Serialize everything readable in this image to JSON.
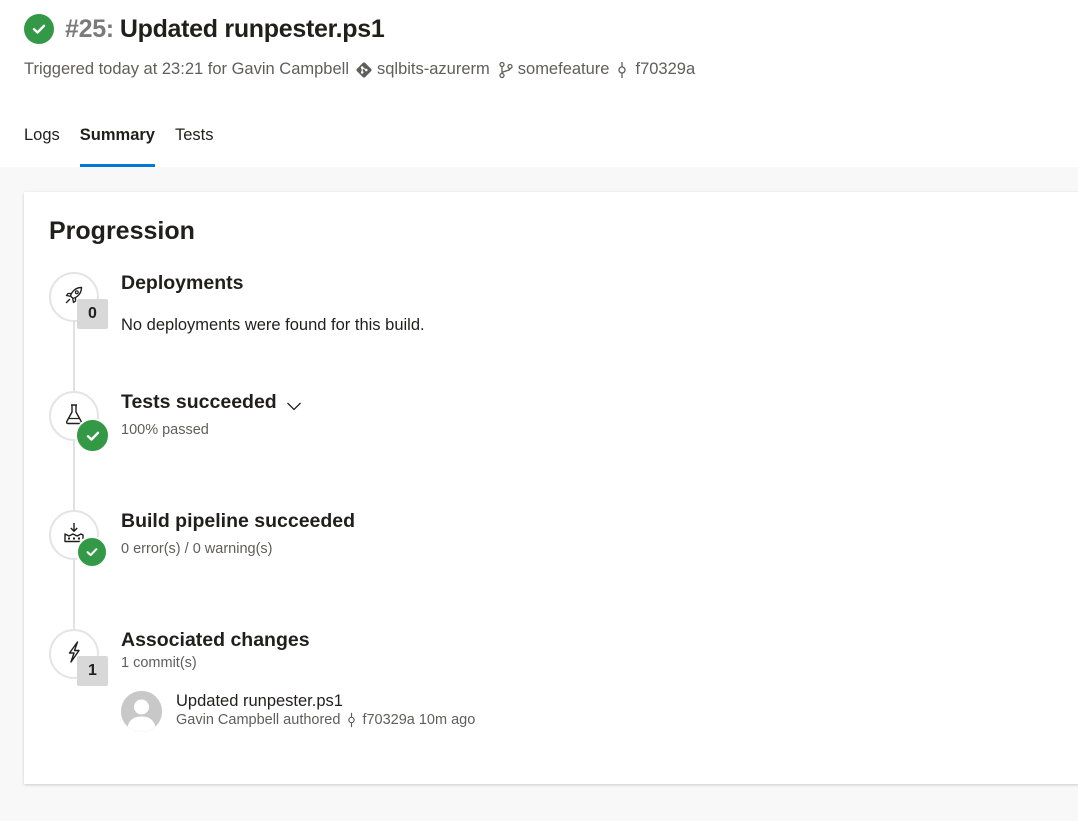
{
  "run": {
    "number": "#25:",
    "title": "Updated runpester.ps1"
  },
  "meta": {
    "triggered_text": "Triggered today at 23:21 for Gavin Campbell",
    "repo": "sqlbits-azurerm",
    "branch": "somefeature",
    "commit": "f70329a"
  },
  "tabs": [
    {
      "label": "Logs",
      "active": false
    },
    {
      "label": "Summary",
      "active": true
    },
    {
      "label": "Tests",
      "active": false
    }
  ],
  "progression": {
    "title": "Progression",
    "deployments": {
      "title": "Deployments",
      "count": "0",
      "text": "No deployments were found for this build.",
      "icon": "rocket-icon"
    },
    "tests": {
      "title": "Tests succeeded",
      "sub": "100% passed",
      "icon": "beaker-icon"
    },
    "build": {
      "title": "Build pipeline succeeded",
      "sub": "0 error(s) / 0 warning(s)",
      "icon": "build-queue-icon"
    },
    "changes": {
      "title": "Associated changes",
      "count": "1",
      "sub": "1 commit(s)",
      "icon": "lightning-icon",
      "commits": [
        {
          "message": "Updated runpester.ps1",
          "author_text": "Gavin Campbell authored",
          "hash": "f70329a",
          "time": "10m ago"
        }
      ]
    }
  },
  "colors": {
    "success": "#339947",
    "accent": "#0078d4",
    "badge": "#d8d8d8"
  }
}
